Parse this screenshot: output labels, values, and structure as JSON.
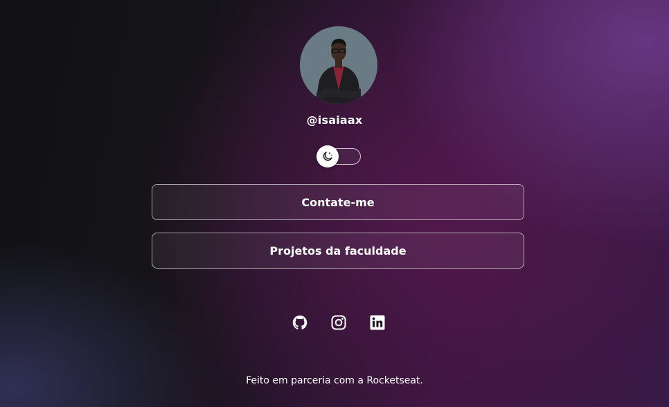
{
  "profile": {
    "username": "@isaiaax",
    "avatar_icon": "profile-photo"
  },
  "theme_toggle": {
    "icon": "moon-stars-icon",
    "state": "dark"
  },
  "links": [
    {
      "label": "Contate-me"
    },
    {
      "label": "Projetos da faculdade"
    }
  ],
  "social": [
    {
      "icon": "github-icon"
    },
    {
      "icon": "instagram-icon"
    },
    {
      "icon": "linkedin-icon"
    }
  ],
  "footer": {
    "text": "Feito em parceria com a Rocketseat."
  },
  "colors": {
    "background_dark": "#111113",
    "background_accent": "#3c1540",
    "text": "#ffffff"
  }
}
